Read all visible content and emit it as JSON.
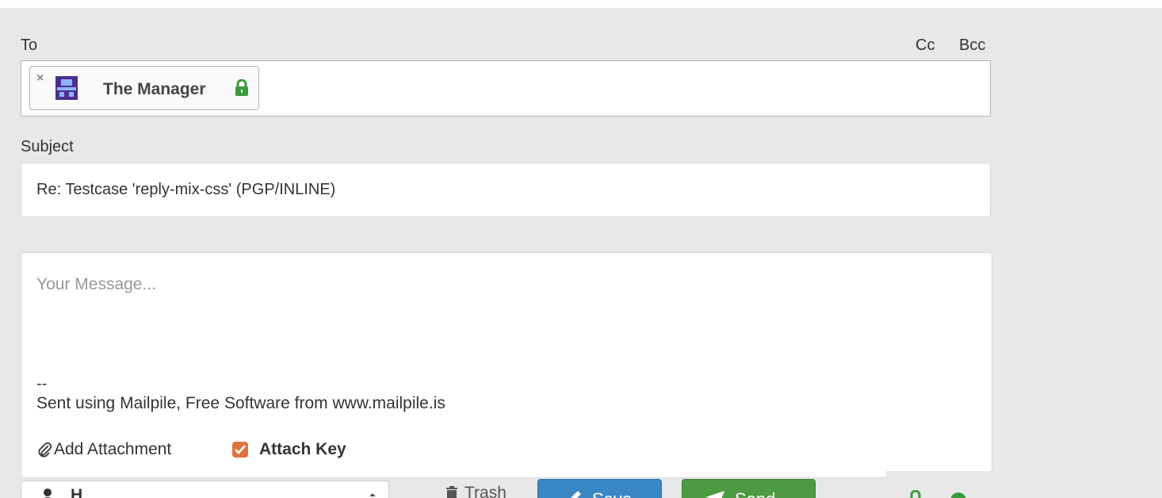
{
  "to": {
    "label": "To",
    "cc_label": "Cc",
    "bcc_label": "Bcc",
    "recipients": [
      {
        "name": "The Manager",
        "remove_icon": "close-icon",
        "avatar_icon": "avatar-icon",
        "encryption_icon": "lock-icon"
      }
    ],
    "remove_glyph": "×"
  },
  "subject": {
    "label": "Subject",
    "value": "Re: Testcase 'reply-mix-css' (PGP/INLINE)"
  },
  "message": {
    "placeholder": "Your Message...",
    "signature_separator": "--",
    "signature": "Sent using Mailpile, Free Software from www.mailpile.is"
  },
  "attachments": {
    "add_label": "Add Attachment",
    "attach_key_label": "Attach Key",
    "attach_key_checked": true
  },
  "footer": {
    "from_value": "H",
    "trash_label": "Trash",
    "save_label": "Save",
    "send_label": "Send"
  },
  "colors": {
    "panel_bg": "#e8e8e8",
    "save_button": "#3a87c6",
    "send_button": "#4c9b42",
    "lock_green": "#3c9a3c",
    "checkbox_orange": "#e0733d",
    "avatar_purple": "#4b2f8f"
  }
}
